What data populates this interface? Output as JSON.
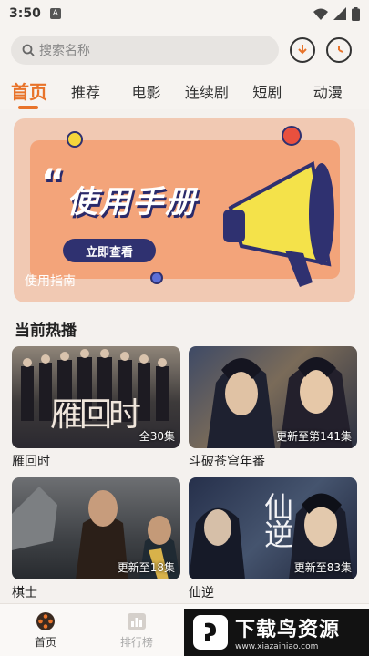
{
  "status": {
    "time": "3:50",
    "a_icon": "A"
  },
  "search": {
    "placeholder": "搜索名称"
  },
  "tabs": [
    "首页",
    "推荐",
    "电影",
    "连续剧",
    "短剧",
    "动漫"
  ],
  "banner": {
    "quote": "“",
    "title": "使用手册",
    "button": "立即查看",
    "caption": "使用指南"
  },
  "section": {
    "hot_title": "当前热播"
  },
  "videos": [
    {
      "title": "雁回时",
      "badge": "全30集",
      "overlay": "雁回时"
    },
    {
      "title": "斗破苍穹年番",
      "badge": "更新至第141集"
    },
    {
      "title": "棋士",
      "badge": "更新至18集"
    },
    {
      "title": "仙逆",
      "badge": "更新至83集",
      "overlay": "仙逆"
    }
  ],
  "bottom_nav": [
    {
      "label": "首页",
      "icon": "home-film-icon"
    },
    {
      "label": "排行榜",
      "icon": "chart-icon"
    }
  ],
  "watermark": {
    "title": "下载鸟资源",
    "url": "www.xiazainiao.com"
  },
  "colors": {
    "accent": "#e8732a",
    "banner_bg": "#f1c9b3",
    "banner_card": "#f3a47a",
    "navy": "#2f3170"
  }
}
